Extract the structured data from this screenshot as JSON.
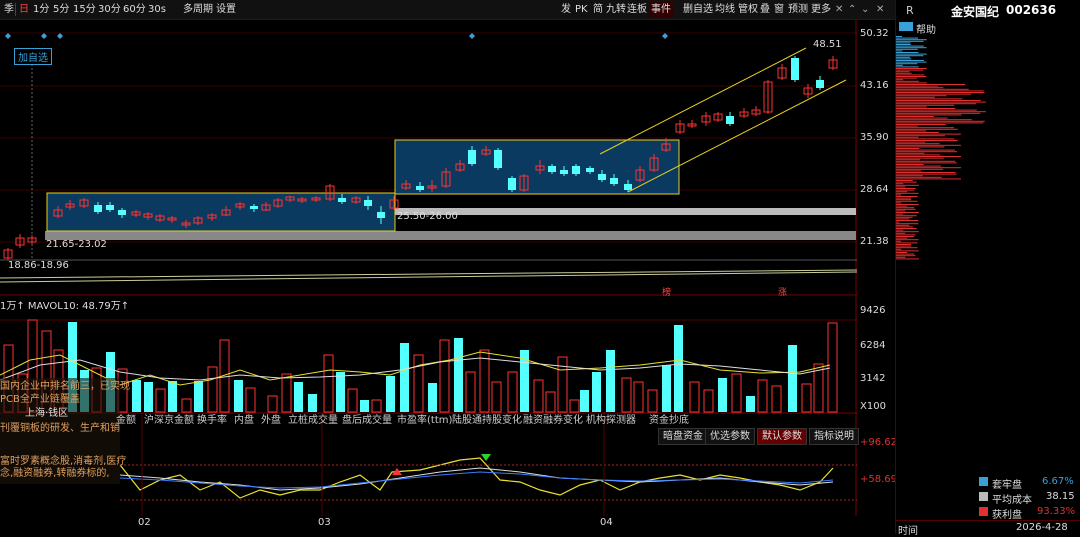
{
  "toolbar": {
    "periods": [
      "季",
      "日",
      "1分",
      "5分",
      "15分",
      "30分",
      "60分",
      "30s",
      "多周期",
      "设置"
    ],
    "right_tools": [
      "发",
      "PK",
      "简",
      "九转",
      "连板",
      "事件",
      "删自选",
      "均线",
      "管权",
      "叠",
      "窗",
      "预测",
      "更多"
    ],
    "window_controls": [
      "✕",
      "⌃",
      "⌄",
      "✕"
    ]
  },
  "stock": {
    "name": "金安国纪",
    "code": "002636",
    "r_label": "R",
    "help_label": "帮助"
  },
  "price_axis": [
    "50.32",
    "43.16",
    "35.90",
    "28.64",
    "21.38"
  ],
  "annotations": {
    "add_watchlist": "加自选",
    "high_price": "48.51",
    "box1_range": "21.65-23.02",
    "box2_range": "25.50-26.00",
    "low_range": "18.86-18.96",
    "event_marks": [
      "榜",
      "涨"
    ]
  },
  "volume": {
    "label": "1万↑ MAVOL10: 48.79万↑",
    "axis": [
      "9426",
      "6284",
      "3142",
      "X100"
    ]
  },
  "news_popups": [
    "国内企业中排名前三，已实现",
    "PCB全产业链覆盖",
    "上海·钱区",
    "刊覆铜板的研发、生产和销",
    "富时罗素概念股,消毒剂,医疗",
    "念,融资融券,转融券标的,"
  ],
  "indicator_tabs": [
    "金额",
    "沪深京金额",
    "换手率",
    "内盘",
    "外盘",
    "立桩成交量",
    "盘后成交量",
    "市盈率(ttm)",
    "陆股通持股变化",
    "融资融券变化",
    "机构探测器",
    "资金抄底"
  ],
  "indicator_buttons": [
    "暗盘资金",
    "优选参数",
    "默认参数",
    "指标说明"
  ],
  "lower_axis": [
    "+96.62",
    "+58.69"
  ],
  "months": [
    "02",
    "03",
    "04"
  ],
  "chip_stats": [
    {
      "label": "套牢盘",
      "value": "6.67%",
      "color": "#3aa0d8"
    },
    {
      "label": "平均成本",
      "value": "38.15",
      "color": "#bbbbbb"
    },
    {
      "label": "获利盘",
      "value": "93.33%",
      "color": "#e03030"
    }
  ],
  "footer": {
    "time_label": "时间",
    "date": "2026-4-28"
  },
  "colors": {
    "up": "#ff3232",
    "down": "#54ffff",
    "box": "#f0e010",
    "ma": "#e8e030"
  }
}
